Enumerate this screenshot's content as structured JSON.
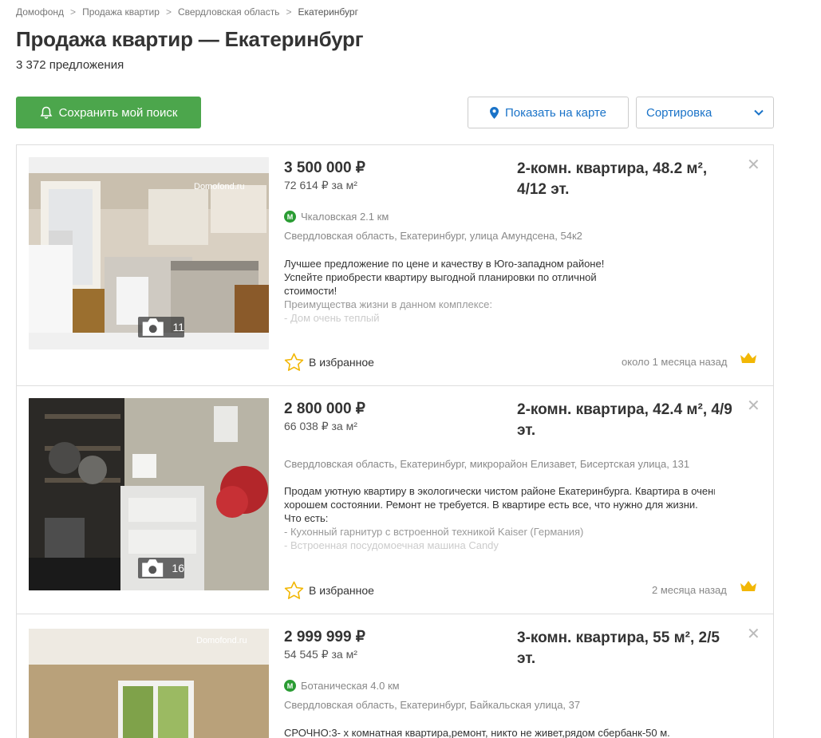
{
  "breadcrumb": [
    "Домофонд",
    "Продажа квартир",
    "Свердловская область",
    "Екатеринбург"
  ],
  "breadcrumb_sep": ">",
  "page_title": "Продажа квартир — Екатеринбург",
  "offers_count": "3 372 предложения",
  "toolbar": {
    "save_label": "Сохранить мой поиск",
    "map_label": "Показать на карте",
    "sort_label": "Сортировка"
  },
  "colors": {
    "green": "#4ca64c",
    "link_blue": "#1a73c8",
    "metro_green": "#2a9c33",
    "star": "#f2b705"
  },
  "listings": [
    {
      "price": "3 500 000 ₽",
      "price_sqm": "72 614 ₽ за м²",
      "title": "2-комн. квартира, 48.2 м², 4/12 эт.",
      "metro": "Чкаловская 2.1 км",
      "address": "Свердловская область, Екатеринбург, улица Амундсена, 54к2",
      "photo_count": "11",
      "watermark": "Domofond.ru",
      "description": [
        "Лучшее предложение по цене и качеству в Юго-западном районе!",
        "Успейте приобрести квартиру выгодной планировки по отличной",
        "стоимости!",
        "Преимущества жизни в данном комплексе:",
        "- Дом очень теплый"
      ],
      "favorite_label": "В избранное",
      "posted": "около 1 месяца назад"
    },
    {
      "price": "2 800 000 ₽",
      "price_sqm": "66 038 ₽ за м²",
      "title": "2-комн. квартира, 42.4 м², 4/9 эт.",
      "address": "Свердловская область, Екатеринбург, микрорайон Елизавет, Бисертская улица, 131",
      "photo_count": "16",
      "description": [
        "Продам уютную квартиру в экологически чистом районе Екатеринбурга. Квартира в очень",
        "хорошем состоянии. Ремонт не требуется. В квартире есть все, что нужно для жизни.",
        "Что есть:",
        "- Кухонный гарнитур с встроенной техникой Kaiser (Германия)",
        "- Встроенная посудомоечная машина Candy"
      ],
      "favorite_label": "В избранное",
      "posted": "2 месяца назад"
    },
    {
      "price": "2 999 999 ₽",
      "price_sqm": "54 545 ₽ за м²",
      "title": "3-комн. квартира, 55 м², 2/5 эт.",
      "metro": "Ботаническая 4.0 км",
      "address": "Свердловская область, Екатеринбург, Байкальская улица, 37",
      "watermark": "Domofond.ru",
      "description": [
        "СРОЧНО:3- х комнатная квартира,ремонт, никто не живет,рядом сбербанк-50 м."
      ]
    }
  ]
}
